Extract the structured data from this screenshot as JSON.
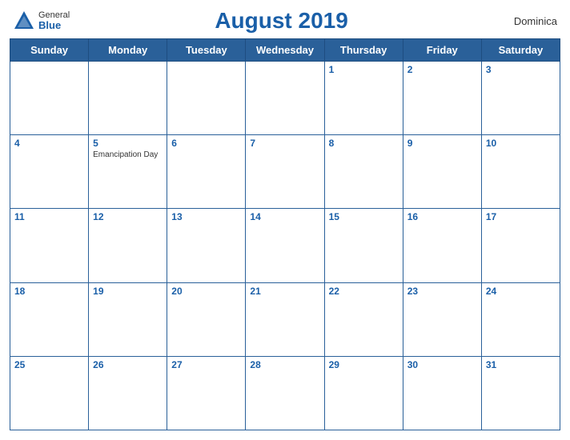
{
  "header": {
    "logo": {
      "general": "General",
      "blue": "Blue",
      "icon": "▲"
    },
    "title": "August 2019",
    "country": "Dominica"
  },
  "days_of_week": [
    "Sunday",
    "Monday",
    "Tuesday",
    "Wednesday",
    "Thursday",
    "Friday",
    "Saturday"
  ],
  "weeks": [
    [
      {
        "day": "",
        "empty": true
      },
      {
        "day": "",
        "empty": true
      },
      {
        "day": "",
        "empty": true
      },
      {
        "day": "",
        "empty": true
      },
      {
        "day": "1",
        "event": ""
      },
      {
        "day": "2",
        "event": ""
      },
      {
        "day": "3",
        "event": ""
      }
    ],
    [
      {
        "day": "4",
        "event": ""
      },
      {
        "day": "5",
        "event": "Emancipation Day"
      },
      {
        "day": "6",
        "event": ""
      },
      {
        "day": "7",
        "event": ""
      },
      {
        "day": "8",
        "event": ""
      },
      {
        "day": "9",
        "event": ""
      },
      {
        "day": "10",
        "event": ""
      }
    ],
    [
      {
        "day": "11",
        "event": ""
      },
      {
        "day": "12",
        "event": ""
      },
      {
        "day": "13",
        "event": ""
      },
      {
        "day": "14",
        "event": ""
      },
      {
        "day": "15",
        "event": ""
      },
      {
        "day": "16",
        "event": ""
      },
      {
        "day": "17",
        "event": ""
      }
    ],
    [
      {
        "day": "18",
        "event": ""
      },
      {
        "day": "19",
        "event": ""
      },
      {
        "day": "20",
        "event": ""
      },
      {
        "day": "21",
        "event": ""
      },
      {
        "day": "22",
        "event": ""
      },
      {
        "day": "23",
        "event": ""
      },
      {
        "day": "24",
        "event": ""
      }
    ],
    [
      {
        "day": "25",
        "event": ""
      },
      {
        "day": "26",
        "event": ""
      },
      {
        "day": "27",
        "event": ""
      },
      {
        "day": "28",
        "event": ""
      },
      {
        "day": "29",
        "event": ""
      },
      {
        "day": "30",
        "event": ""
      },
      {
        "day": "31",
        "event": ""
      }
    ]
  ]
}
